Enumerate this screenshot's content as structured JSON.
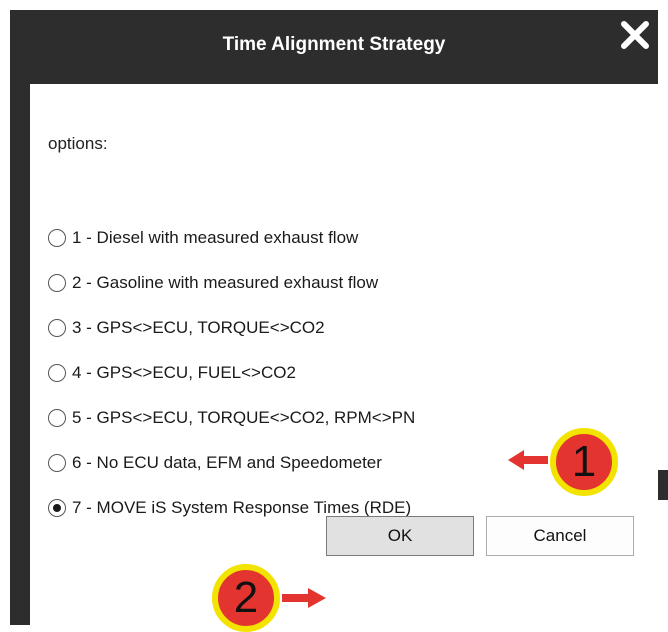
{
  "dialog": {
    "title": "Time Alignment Strategy",
    "close_icon": "close-x-icon"
  },
  "content": {
    "options_label": "options:",
    "options": [
      {
        "label": "1 - Diesel with measured exhaust flow",
        "checked": false
      },
      {
        "label": "2 - Gasoline with measured exhaust flow",
        "checked": false
      },
      {
        "label": "3 - GPS<>ECU, TORQUE<>CO2",
        "checked": false
      },
      {
        "label": "4 - GPS<>ECU, FUEL<>CO2",
        "checked": false
      },
      {
        "label": "5 - GPS<>ECU, TORQUE<>CO2, RPM<>PN",
        "checked": false
      },
      {
        "label": "6 - No ECU data, EFM and Speedometer",
        "checked": false
      },
      {
        "label": "7 - MOVE iS System Response Times (RDE)",
        "checked": true
      }
    ]
  },
  "buttons": {
    "ok_label": "OK",
    "cancel_label": "Cancel"
  },
  "annotations": {
    "step1": "1",
    "step2": "2",
    "arrow_color": "#e3342f",
    "badge_ring_color": "#f2e300"
  },
  "colors": {
    "titlebar": "#2d2d2d",
    "content_bg": "#ffffff"
  }
}
